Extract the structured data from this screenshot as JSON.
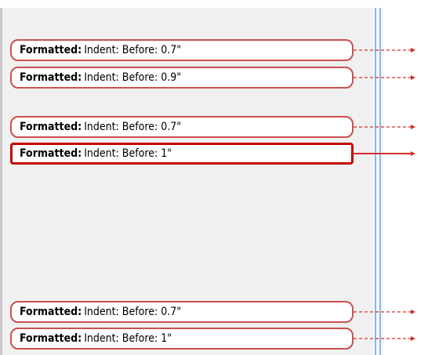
{
  "colors": {
    "balloon_border": "#c95050",
    "selected_border": "#c40000",
    "connector": "#d32f2f",
    "pane_background": "#f0f0f0",
    "splitter": "#8bb7e6"
  },
  "comments_pane": {
    "balloons": [
      {
        "label": "Formatted:",
        "detail": "Indent: Before:  0.7\"",
        "selected": false
      },
      {
        "label": "Formatted:",
        "detail": "Indent: Before:  0.9\"",
        "selected": false
      },
      {
        "label": "Formatted:",
        "detail": "Indent: Before:  0.7\"",
        "selected": false
      },
      {
        "label": "Formatted:",
        "detail": "Indent: Before:  1\"",
        "selected": true
      },
      {
        "label": "Formatted:",
        "detail": "Indent: Before:  0.7\"",
        "selected": false
      },
      {
        "label": "Formatted:",
        "detail": "Indent: Before:  1\"",
        "selected": false
      }
    ]
  }
}
